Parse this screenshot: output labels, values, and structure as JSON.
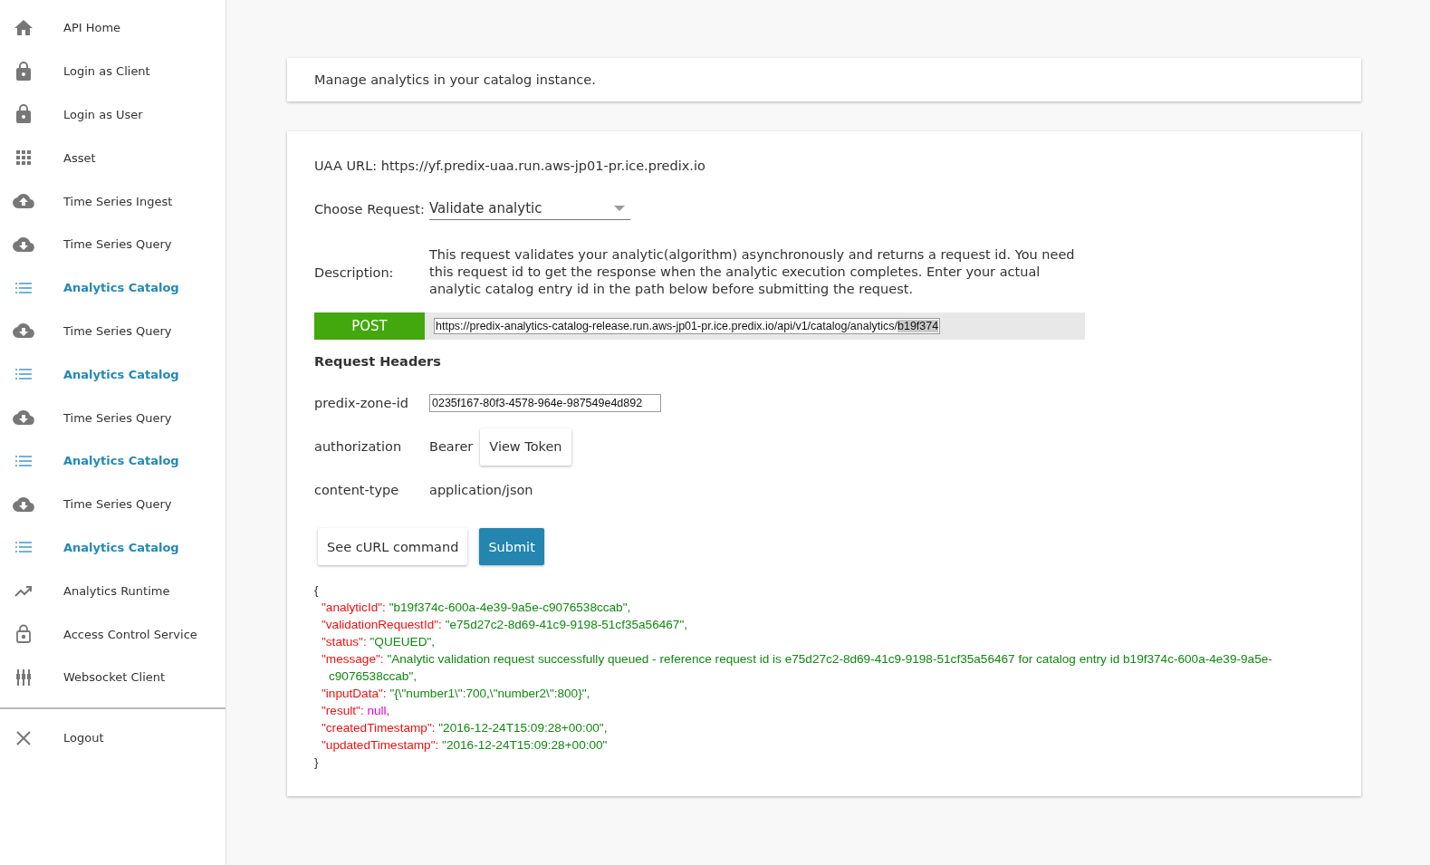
{
  "sidebar": {
    "items": [
      {
        "label": "API Home",
        "kind": "home",
        "selected": false
      },
      {
        "label": "Login as Client",
        "kind": "lock",
        "selected": false
      },
      {
        "label": "Login as User",
        "kind": "lock",
        "selected": false
      },
      {
        "label": "Asset",
        "kind": "grid",
        "selected": false
      },
      {
        "label": "Time Series Ingest",
        "kind": "upload",
        "selected": false
      },
      {
        "label": "Time Series Query",
        "kind": "download",
        "selected": false
      },
      {
        "label": "Analytics Catalog",
        "kind": "list",
        "selected": true
      },
      {
        "label": "Time Series Query",
        "kind": "download",
        "selected": false
      },
      {
        "label": "Analytics Catalog",
        "kind": "list",
        "selected": true
      },
      {
        "label": "Time Series Query",
        "kind": "download",
        "selected": false
      },
      {
        "label": "Analytics Catalog",
        "kind": "list",
        "selected": true
      },
      {
        "label": "Time Series Query",
        "kind": "download",
        "selected": false
      },
      {
        "label": "Analytics Catalog",
        "kind": "list",
        "selected": true
      },
      {
        "label": "Analytics Runtime",
        "kind": "trend",
        "selected": false
      },
      {
        "label": "Access Control Service",
        "kind": "padlock",
        "selected": false
      },
      {
        "label": "Websocket Client",
        "kind": "sliders",
        "selected": false
      }
    ],
    "footer": {
      "label": "Logout",
      "kind": "close"
    }
  },
  "intro": "Manage analytics in your catalog instance.",
  "form": {
    "uaa": "UAA URL: https://yf.predix-uaa.run.aws-jp01-pr.ice.predix.io",
    "choose_label": "Choose Request:",
    "choose_value": "Validate analytic",
    "description_label": "Description:",
    "description": "This request validates your analytic(algorithm) asynchronously and returns a request id. You need this request id to get the response when the analytic execution completes. Enter your actual analytic catalog entry id in the path below before submitting the request.",
    "method": "POST",
    "url": "https://predix-analytics-catalog-release.run.aws-jp01-pr.ice.predix.io/api/v1/catalog/analytics/",
    "url_selected": "b19f374",
    "headers_title": "Request Headers",
    "headers": [
      {
        "kind": "input",
        "name": "predix-zone-id",
        "value": "0235f167-80f3-4578-964e-987549e4d892"
      },
      {
        "kind": "token",
        "name": "authorization",
        "value": "Bearer",
        "button": "View Token"
      },
      {
        "kind": "text",
        "name": "content-type",
        "value": "application/json"
      }
    ],
    "buttons": [
      {
        "label": "See cURL command",
        "kind": "secondary"
      },
      {
        "label": "Submit",
        "kind": "primary"
      }
    ]
  },
  "response": {
    "open": "{",
    "close": "}",
    "lines": [
      {
        "key": "\"analyticId\":",
        "value": "\"b19f374c-600a-4e39-9a5e-c9076538ccab\",",
        "kind": "string"
      },
      {
        "key": "\"validationRequestId\":",
        "value": "\"e75d27c2-8d69-41c9-9198-51cf35a56467\",",
        "kind": "string"
      },
      {
        "key": "\"status\":",
        "value": "\"QUEUED\",",
        "kind": "string"
      },
      {
        "key": "\"message\":",
        "value": "\"Analytic validation request successfully queued - reference request id is e75d27c2-8d69-41c9-9198-51cf35a56467 for catalog entry id b19f374c-600a-4e39-9a5e-c9076538ccab\",",
        "kind": "string"
      },
      {
        "key": "\"inputData\":",
        "value": "\"{\\\"number1\\\":700,\\\"number2\\\":800}\",",
        "kind": "string"
      },
      {
        "key": "\"result\":",
        "value": "null,",
        "kind": "null"
      },
      {
        "key": "\"createdTimestamp\":",
        "value": "\"2016-12-24T15:09:28+00:00\",",
        "kind": "string"
      },
      {
        "key": "\"updatedTimestamp\":",
        "value": "\"2016-12-24T15:09:28+00:00\"",
        "kind": "string"
      }
    ]
  }
}
